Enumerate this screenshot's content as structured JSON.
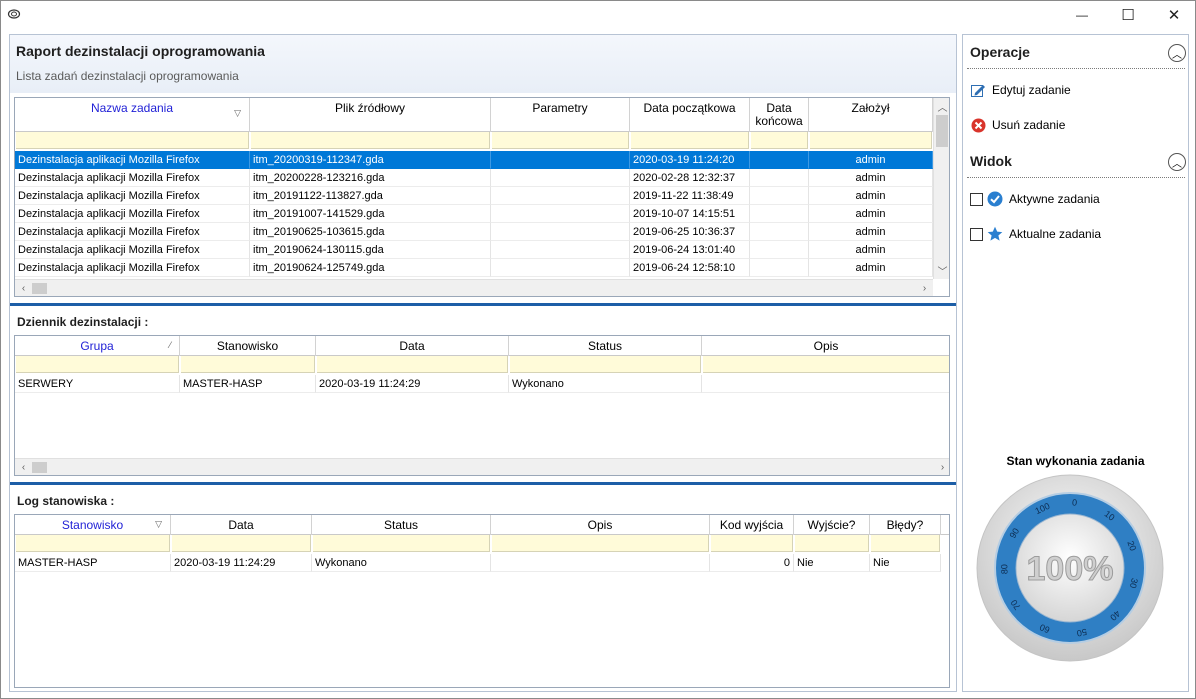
{
  "window": {
    "min_glyph": "—",
    "max_glyph": "☐",
    "close_glyph": "✕"
  },
  "report": {
    "title": "Raport dezinstalacji oprogramowania",
    "subtitle": "Lista zadań dezinstalacji oprogramowania"
  },
  "tasks": {
    "columns": [
      "Nazwa zadania",
      "Plik źródłowy",
      "Parametry",
      "Data początkowa",
      "Data końcowa",
      "Założył"
    ],
    "rows": [
      {
        "name": "Dezinstalacja aplikacji Mozilla Firefox",
        "file": "itm_20200319-112347.gda",
        "params": "",
        "start": "2020-03-19 11:24:20",
        "end": "",
        "owner": "admin"
      },
      {
        "name": "Dezinstalacja aplikacji Mozilla Firefox",
        "file": "itm_20200228-123216.gda",
        "params": "",
        "start": "2020-02-28 12:32:37",
        "end": "",
        "owner": "admin"
      },
      {
        "name": "Dezinstalacja aplikacji Mozilla Firefox",
        "file": "itm_20191122-113827.gda",
        "params": "",
        "start": "2019-11-22 11:38:49",
        "end": "",
        "owner": "admin"
      },
      {
        "name": "Dezinstalacja aplikacji Mozilla Firefox",
        "file": "itm_20191007-141529.gda",
        "params": "",
        "start": "2019-10-07 14:15:51",
        "end": "",
        "owner": "admin"
      },
      {
        "name": "Dezinstalacja aplikacji Mozilla Firefox",
        "file": "itm_20190625-103615.gda",
        "params": "",
        "start": "2019-06-25 10:36:37",
        "end": "",
        "owner": "admin"
      },
      {
        "name": "Dezinstalacja aplikacji Mozilla Firefox",
        "file": "itm_20190624-130115.gda",
        "params": "",
        "start": "2019-06-24 13:01:40",
        "end": "",
        "owner": "admin"
      },
      {
        "name": "Dezinstalacja aplikacji Mozilla Firefox",
        "file": "itm_20190624-125749.gda",
        "params": "",
        "start": "2019-06-24 12:58:10",
        "end": "",
        "owner": "admin"
      }
    ],
    "selected_index": 0
  },
  "journal": {
    "label": "Dziennik dezinstalacji :",
    "columns": [
      "Grupa",
      "Stanowisko",
      "Data",
      "Status",
      "Opis"
    ],
    "rows": [
      {
        "group": "SERWERY",
        "station": "MASTER-HASP",
        "date": "2020-03-19 11:24:29",
        "status": "Wykonano",
        "desc": ""
      }
    ]
  },
  "log": {
    "label": "Log stanowiska :",
    "columns": [
      "Stanowisko",
      "Data",
      "Status",
      "Opis",
      "Kod wyjścia",
      "Wyjście?",
      "Błędy?"
    ],
    "rows": [
      {
        "station": "MASTER-HASP",
        "date": "2020-03-19 11:24:29",
        "status": "Wykonano",
        "desc": "",
        "code": "0",
        "exit": "Nie",
        "errors": "Nie"
      }
    ]
  },
  "sidebar": {
    "operations": {
      "title": "Operacje",
      "items": [
        {
          "label": "Edytuj zadanie",
          "icon": "edit-icon"
        },
        {
          "label": "Usuń zadanie",
          "icon": "delete-icon"
        }
      ]
    },
    "view": {
      "title": "Widok",
      "items": [
        {
          "label": "Aktywne zadania",
          "icon": "check-circle-icon",
          "checked": false
        },
        {
          "label": "Aktualne zadania",
          "icon": "star-icon",
          "checked": false
        }
      ]
    },
    "gauge": {
      "title": "Stan wykonania zadania",
      "value_text": "100%",
      "value": 100,
      "ticks": [
        "0",
        "10",
        "20",
        "30",
        "40",
        "50",
        "60",
        "70",
        "80",
        "90",
        "100"
      ]
    }
  },
  "colors": {
    "accent": "#0078d7",
    "splitter": "#1c5ea7",
    "filter_bg": "#fffbd9",
    "gauge_ring": "#2f7fc4"
  }
}
